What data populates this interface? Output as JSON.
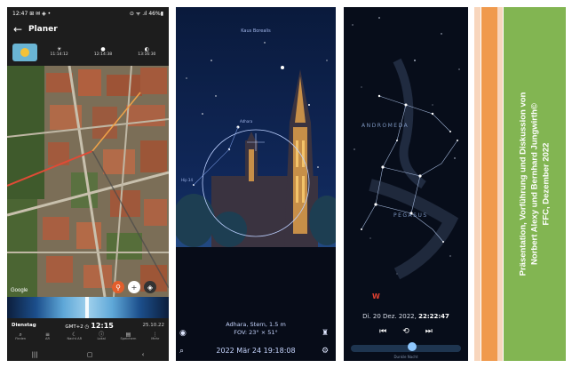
{
  "panel1": {
    "status": {
      "time": "12:47",
      "icons_left": "⊞ ✉ ◈ •",
      "icons_right": "⊙ ᯤ .ıl 46%▮"
    },
    "header": {
      "back_icon": "arrow-back-icon",
      "title": "Planer"
    },
    "times": [
      {
        "icon": "☀",
        "label": "11:14:12"
      },
      {
        "icon": "●",
        "label": "12:14:38"
      },
      {
        "icon": "◐",
        "label": "13:16:30"
      }
    ],
    "map_watermark": "Google",
    "day": {
      "label": "Dienstag",
      "tz": "GMT+2",
      "time": "12:15",
      "date": "25.10.22"
    },
    "nav": [
      {
        "icon": "⌕",
        "label": "Finden"
      },
      {
        "icon": "≡",
        "label": "AR"
      },
      {
        "icon": "☾",
        "label": "Nacht AR"
      },
      {
        "icon": "ⓘ",
        "label": "Lokal"
      },
      {
        "icon": "▤",
        "label": "Speichern"
      },
      {
        "icon": "⋮",
        "label": "Mehr"
      }
    ],
    "sysnav": [
      "|||",
      "▢",
      "‹"
    ]
  },
  "panel2": {
    "top_label": "Kaus Borealis",
    "star_labels": [
      "Adhara",
      "Hip 34"
    ],
    "info_line1": "Adhara, Stern, 1.5 m",
    "info_line2": "FOV: 23° × 51°",
    "date": "2022 Mär 24 19:18:08"
  },
  "panel3": {
    "constellations": [
      "ANDROMEDA",
      "PEGASUS"
    ],
    "compass": "W",
    "date_prefix": "Di. 20 Dez. 2022,",
    "time": "22:22:47",
    "slider_label": "Dunkle Nacht"
  },
  "credits": {
    "line1": "Präsentation, Vorführung  und Diskussion von",
    "line2": "Norbert Alexy und Bernhard Jungwirth©",
    "line3": "FFC,  Dezember 2022"
  },
  "colors": {
    "green_panel": "#82b552",
    "orange_stripe": "#f09a4d",
    "light_stripe": "#f8d6bd"
  }
}
